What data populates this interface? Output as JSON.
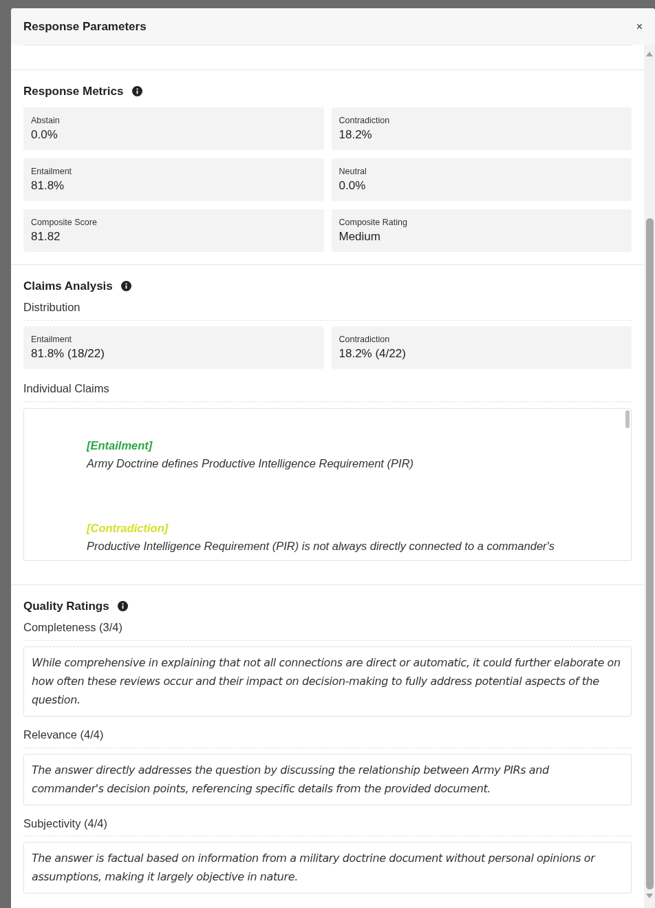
{
  "dialog": {
    "title": "Response Parameters",
    "close": "×"
  },
  "response_metrics": {
    "title": "Response Metrics",
    "metrics": [
      {
        "label": "Abstain",
        "value": "0.0%"
      },
      {
        "label": "Contradiction",
        "value": "18.2%"
      },
      {
        "label": "Entailment",
        "value": "81.8%"
      },
      {
        "label": "Neutral",
        "value": "0.0%"
      },
      {
        "label": "Composite Score",
        "value": "81.82"
      },
      {
        "label": "Composite Rating",
        "value": "Medium"
      }
    ]
  },
  "claims_analysis": {
    "title": "Claims Analysis",
    "distribution_label": "Distribution",
    "distribution": [
      {
        "label": "Entailment",
        "value": "81.8% (18/22)"
      },
      {
        "label": "Contradiction",
        "value": "18.2% (4/22)"
      }
    ],
    "individual_claims_label": "Individual Claims",
    "claims": [
      {
        "label": "[Entailment]",
        "text": "Army Doctrine defines Productive Intelligence Requirement (PIR)",
        "color": "#28a745"
      },
      {
        "label": "[Contradiction]",
        "text": "Productive Intelligence Requirement (PIR) is not always directly connected to a commander's",
        "color": "#d4e02a"
      }
    ]
  },
  "quality_ratings": {
    "title": "Quality Ratings",
    "ratings": [
      {
        "heading": "Completeness (3/4)",
        "comment": "While comprehensive in explaining that not all connections are direct or automatic, it could further elaborate on how often these reviews occur and their impact on decision-making to fully address potential aspects of the question."
      },
      {
        "heading": "Relevance (4/4)",
        "comment": "The answer directly addresses the question by discussing the relationship between Army PIRs and commander's decision points, referencing specific details from the provided document."
      },
      {
        "heading": "Subjectivity (4/4)",
        "comment": "The answer is factual based on information from a military doctrine document without personal opinions or assumptions, making it largely objective in nature."
      }
    ]
  }
}
